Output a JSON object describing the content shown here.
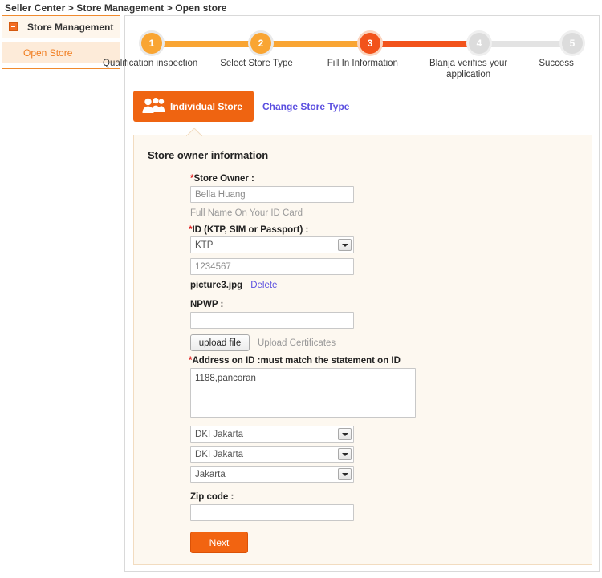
{
  "breadcrumb": {
    "text": "Seller Center > Store Management > Open store"
  },
  "sidebar": {
    "header_label": "Store Management",
    "items": [
      {
        "label": "Open Store"
      }
    ]
  },
  "stepper": {
    "steps": [
      {
        "number": "1",
        "label": "Qualification inspection",
        "state": "done"
      },
      {
        "number": "2",
        "label": "Select Store Type",
        "state": "done"
      },
      {
        "number": "3",
        "label": "Fill In Information",
        "state": "active"
      },
      {
        "number": "4",
        "label": "Blanja verifies your application",
        "state": "todo"
      },
      {
        "number": "5",
        "label": "Success",
        "state": "todo"
      }
    ]
  },
  "store_type": {
    "tab_label": "Individual Store",
    "tab_icon": "people-group-icon",
    "change_link_label": "Change Store Type"
  },
  "panel": {
    "title": "Store owner information",
    "fields": {
      "store_owner": {
        "label": "Store Owner :",
        "required": "*",
        "placeholder": "Bella Huang",
        "value": "",
        "hint": "Full Name On Your ID Card"
      },
      "id_type": {
        "label": "ID (KTP, SIM or Passport) :",
        "required": "*",
        "selected": "KTP"
      },
      "id_number": {
        "placeholder": "1234567",
        "value": ""
      },
      "id_file": {
        "name": "picture3.jpg",
        "delete_label": "Delete"
      },
      "npwp": {
        "label": "NPWP :",
        "value": "",
        "placeholder": ""
      },
      "npwp_upload": {
        "button_label": "upload file",
        "hint": "Upload Certificates"
      },
      "address": {
        "label": "Address on ID :must match the statement on ID",
        "required": "*",
        "value": "1188,pancoran"
      },
      "province": {
        "selected": "DKI Jakarta"
      },
      "city": {
        "selected": "DKI Jakarta"
      },
      "district": {
        "selected": "Jakarta"
      },
      "zip_code": {
        "label": "Zip code :",
        "value": "",
        "placeholder": ""
      }
    },
    "submit_label": "Next"
  },
  "colors": {
    "brand_orange": "#EF6411",
    "step_done": "#F9A533",
    "step_active": "#F2531B",
    "step_todo": "#DCDCDC",
    "link_purple": "#5B4FE0",
    "panel_bg": "#FDF8F0",
    "required_red": "#E02020"
  }
}
